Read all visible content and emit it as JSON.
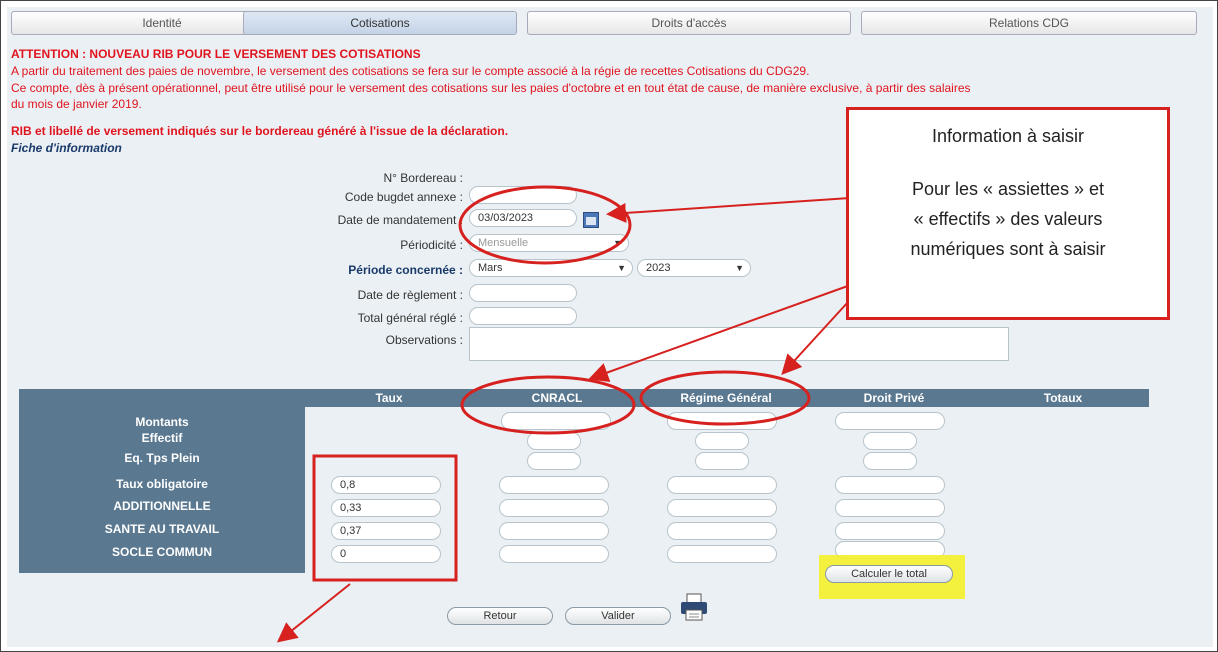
{
  "tabs": [
    {
      "label": "Identité",
      "active": false
    },
    {
      "label": "Cotisations",
      "active": true
    },
    {
      "label": "Droits d'accès",
      "active": false
    },
    {
      "label": "Relations CDG",
      "active": false
    }
  ],
  "notice": {
    "title": "ATTENTION : NOUVEAU RIB POUR LE VERSEMENT DES COTISATIONS",
    "line1": "A partir du traitement des paies de novembre, le versement des cotisations se fera sur le compte associé à la régie de recettes Cotisations du CDG29.",
    "line2": "Ce compte, dès à présent opérationnel, peut être utilisé pour le versement des cotisations sur les paies d'octobre et en tout état de cause, de manière exclusive, à partir des salaires",
    "line3": "du mois de janvier 2019.",
    "line4": "RIB et libellé de versement indiqués sur le bordereau généré à l'issue de la déclaration.",
    "fiche": "Fiche d'information"
  },
  "form": {
    "bordereau_label": "N° Bordereau :",
    "code_budget_label": "Code bugdet annexe :",
    "date_mandatement_label": "Date de mandatement :",
    "date_mandatement_value": "03/03/2023",
    "periodicite_label": "Périodicité :",
    "periodicite_value": "Mensuelle",
    "periode_label": "Période concernée :",
    "periode_mois": "Mars",
    "periode_annee": "2023",
    "date_reglement_label": "Date de règlement :",
    "total_regle_label": "Total général réglé :",
    "observations_label": "Observations :"
  },
  "table": {
    "headers": [
      "Taux",
      "CNRACL",
      "Régime Général",
      "Droit Privé",
      "Totaux"
    ],
    "rows": [
      "Montants",
      "Effectif",
      "Eq. Tps Plein",
      "Taux obligatoire",
      "ADDITIONNELLE",
      "SANTE AU TRAVAIL",
      "SOCLE COMMUN"
    ],
    "taux": [
      "0,8",
      "0,33",
      "0,37",
      "0"
    ]
  },
  "buttons": {
    "calculer": "Calculer le total",
    "retour": "Retour",
    "valider": "Valider"
  },
  "annotation": {
    "title": "Information à saisir",
    "line1": "Pour les « assiettes » et",
    "line2": "« effectifs » des valeurs",
    "line3": "numériques sont à saisir"
  },
  "colors": {
    "annotation_red": "#d6211f",
    "table_header": "#5a7890",
    "highlight_yellow": "#f4f12a"
  }
}
